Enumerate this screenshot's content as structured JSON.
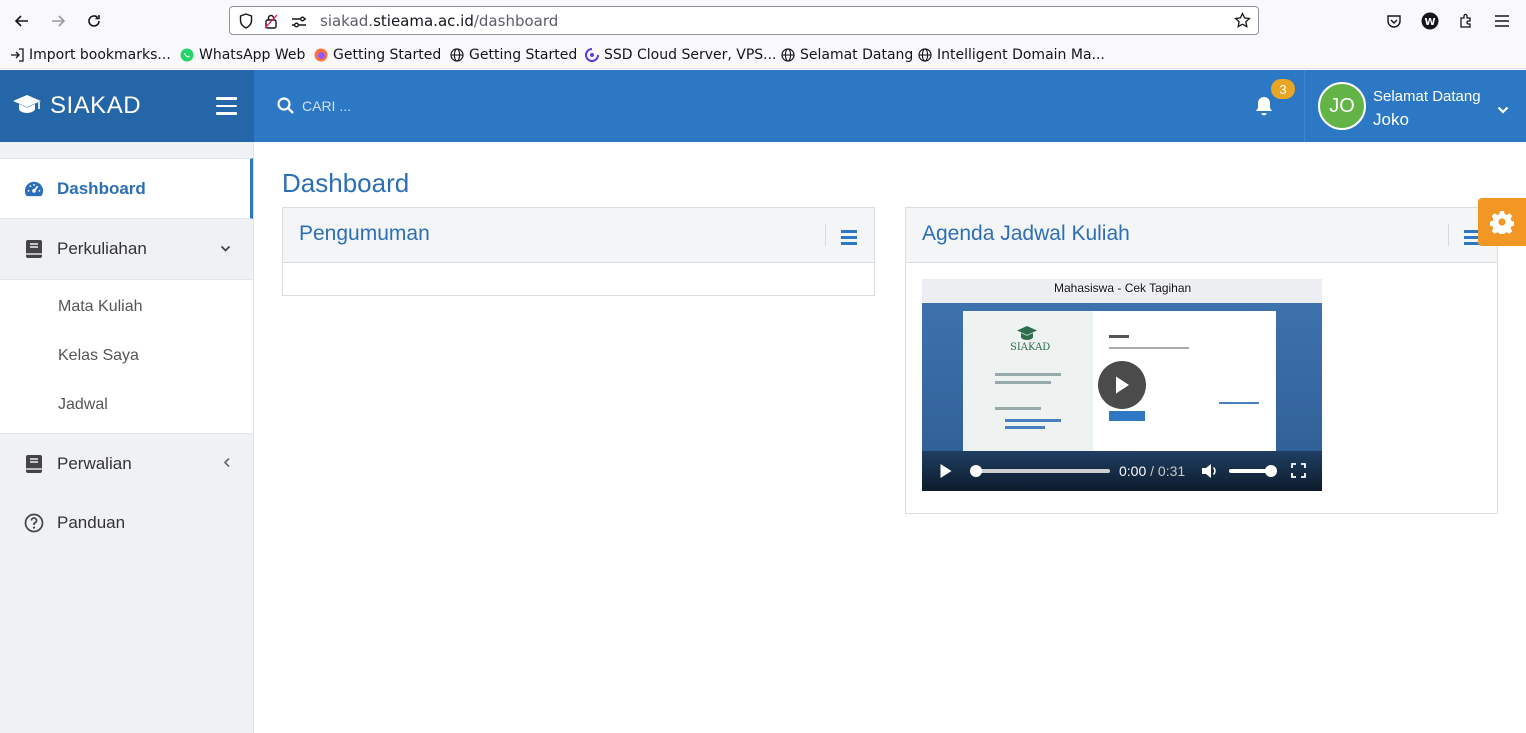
{
  "browser": {
    "url_host": "siakad.",
    "url_domain": "stieama.ac.id",
    "url_path": "/dashboard",
    "bookmarks": [
      "Import bookmarks...",
      "WhatsApp Web",
      "Getting Started",
      "Getting Started",
      "SSD Cloud Server, VPS...",
      "Selamat Datang",
      "Intelligent Domain Ma..."
    ]
  },
  "header": {
    "brand": "SIAKAD",
    "search_placeholder": "CARI ...",
    "notification_count": "3",
    "avatar_initials": "JO",
    "greeting": "Selamat Datang",
    "user_name": "Joko"
  },
  "sidebar": {
    "items": [
      {
        "label": "Dashboard",
        "icon": "gauge-icon"
      },
      {
        "label": "Perkuliahan",
        "icon": "book-icon"
      },
      {
        "label": "Perwalian",
        "icon": "book-icon"
      },
      {
        "label": "Panduan",
        "icon": "question-circle-icon"
      }
    ],
    "submenu": [
      "Mata Kuliah",
      "Kelas Saya",
      "Jadwal"
    ]
  },
  "main": {
    "title": "Dashboard",
    "cards": [
      {
        "title": "Pengumuman"
      },
      {
        "title": "Agenda Jadwal Kuliah"
      }
    ],
    "video": {
      "caption": "Mahasiswa - Cek Tagihan",
      "current_time": "0:00",
      "duration": "/ 0:31",
      "thumbnail_brand": "SIAKAD",
      "progress": 0,
      "volume": 1
    }
  },
  "colors": {
    "brand_dark": "#2466a8",
    "brand": "#2c78c4",
    "accent": "#f29624",
    "badge": "#e9a524",
    "avatar": "#62b446"
  }
}
